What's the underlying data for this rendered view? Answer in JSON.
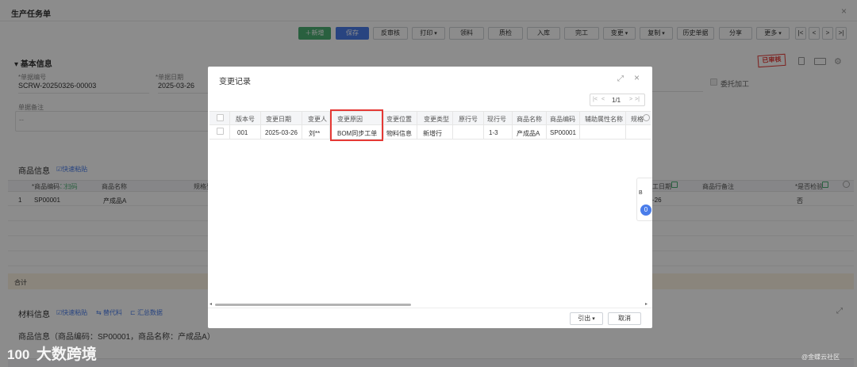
{
  "window": {
    "title": "生产任务单",
    "close_glyph": "×"
  },
  "toolbar": {
    "add": "新增",
    "save": "保存",
    "unaudit": "反审核",
    "print": "打印",
    "pick": "领料",
    "qc": "质检",
    "stock_in": "入库",
    "finish": "完工",
    "change": "变更",
    "copy": "复制",
    "history": "历史单据",
    "share": "分享",
    "more": "更多"
  },
  "pager_nav": [
    "|<",
    "<",
    ">",
    ">|"
  ],
  "basic": {
    "title": "基本信息",
    "doc_no_label": "*单据编号",
    "doc_no": "SCRW-20250326-00003",
    "doc_date_label": "*单据日期",
    "doc_date": "2025-03-26",
    "remark_label": "单据备注",
    "remark_value": "--",
    "outsourcing_label": "委托加工",
    "status_stamp": "已审核"
  },
  "goods": {
    "title": "商品信息",
    "quick_paste": "快速粘贴",
    "headers": {
      "code": "*商品编码",
      "scan": "扫码",
      "name": "商品名称",
      "spec": "规格型",
      "date": "工日期",
      "remark": "商品行备注",
      "inspect": "*是否检验"
    },
    "row": {
      "idx": "1",
      "code": "SP00001",
      "name": "产成品A",
      "date": "-26",
      "inspect": "否"
    },
    "total": "合计"
  },
  "material": {
    "title": "材料信息",
    "quick_paste": "快速粘贴",
    "substitute": "替代料",
    "summary": "汇总数据",
    "subtitle": "商品信息（商品编码：SP00001，商品名称：产成品A）"
  },
  "modal": {
    "title": "变更记录",
    "pager": {
      "first": "|<",
      "prev": "<",
      "page": "1/1",
      "next": ">",
      "last": ">|"
    },
    "headers": [
      "版本号",
      "变更日期",
      "变更人",
      "变更原因",
      "变更位置",
      "变更类型",
      "原行号",
      "现行号",
      "商品名称",
      "商品编码",
      "辅助属性名称",
      "规格"
    ],
    "row": [
      "001",
      "2025-03-26",
      "刘**",
      "BOM同步工单",
      "物料信息",
      "新增行",
      "",
      "1-3",
      "产成品A",
      "SP00001",
      "",
      ""
    ],
    "side_tab": {
      "label": "B",
      "badge": "0"
    },
    "export": "引出",
    "cancel": "取消"
  },
  "watermark": {
    "logo_text": "100",
    "brand": "大数跨境",
    "corner": "@金蝶云社区"
  },
  "colors": {
    "green": "#4caf74",
    "blue": "#4a7dea",
    "highlight": "#e53935",
    "total_bg": "#fbf3e2"
  }
}
